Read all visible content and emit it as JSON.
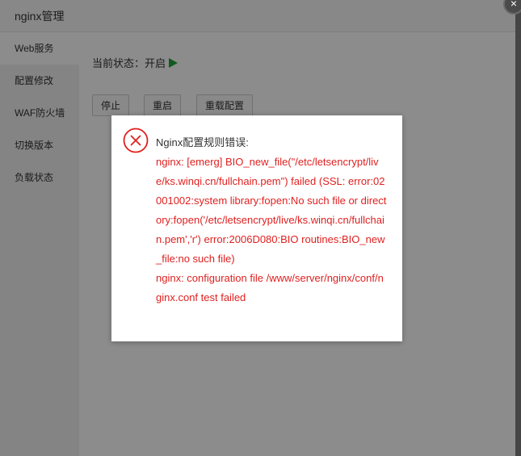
{
  "window": {
    "title": "nginx管理",
    "close": "×"
  },
  "sidebar": {
    "items": [
      {
        "label": "Web服务",
        "active": true
      },
      {
        "label": "配置修改"
      },
      {
        "label": "WAF防火墙"
      },
      {
        "label": "切换版本"
      },
      {
        "label": "负载状态"
      }
    ]
  },
  "main": {
    "status_text": "当前状态：开启",
    "status_icon": "play-icon",
    "status_color": "#20a53a",
    "buttons": {
      "stop": "停止",
      "restart": "重启",
      "reload": "重载配置"
    }
  },
  "dialog": {
    "icon": "error-circle-x-icon",
    "icon_color": "#e02020",
    "heading": "Nginx配置规则错误:",
    "lines": [
      "nginx: [emerg] BIO_new_file(\"/etc/letsencrypt/live/ks.winqi.cn/fullchain.pem\") failed (SSL: error:02001002:system library:fopen:No such file or directory:fopen('/etc/letsencrypt/live/ks.winqi.cn/fullchain.pem','r') error:2006D080:BIO routines:BIO_new_file:no such file)",
      "nginx: configuration file /www/server/nginx/conf/nginx.conf test failed"
    ]
  }
}
